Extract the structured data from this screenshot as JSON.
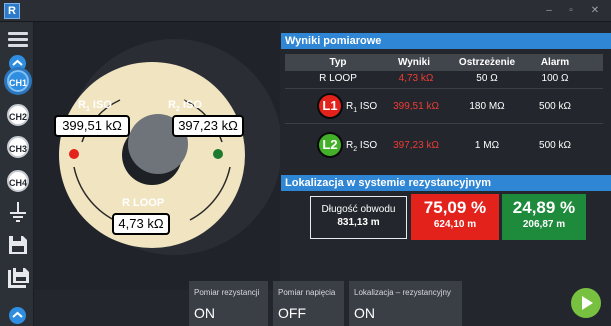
{
  "window": {
    "app_icon_letter": "R",
    "minimize": "–",
    "maximize": "▫",
    "close": "✕"
  },
  "sidebar": {
    "channels": [
      "CH1",
      "CH2",
      "CH3",
      "CH4"
    ],
    "active_channel": "CH1"
  },
  "diagram": {
    "r1_label_main": "R",
    "r1_label_sub": "1",
    "r1_label_suffix": "ISO",
    "r1_value": "399,51 kΩ",
    "r2_label_main": "R",
    "r2_label_sub": "2",
    "r2_label_suffix": "ISO",
    "r2_value": "397,23 kΩ",
    "rloop_label": "R LOOP",
    "rloop_value": "4,73 kΩ",
    "colors": {
      "ring": "#f1e4c0",
      "left_dot": "#e3221c",
      "right_dot": "#1d7a2e"
    }
  },
  "results": {
    "header": "Wyniki pomiarowe",
    "columns": [
      "Typ",
      "Wyniki",
      "Ostrzeżenie",
      "Alarm"
    ],
    "rows": [
      {
        "typ": "R LOOP",
        "wynik": "4,73 kΩ",
        "ostrzezenie": "50 Ω",
        "alarm": "100 Ω"
      },
      {
        "badge": "L1",
        "typ_main": "R",
        "typ_sub": "1",
        "typ_suffix": " ISO",
        "wynik": "399,51 kΩ",
        "ostrzezenie": "180 MΩ",
        "alarm": "500 kΩ"
      },
      {
        "badge": "L2",
        "typ_main": "R",
        "typ_sub": "2",
        "typ_suffix": " ISO",
        "wynik": "397,23 kΩ",
        "ostrzezenie": "1 MΩ",
        "alarm": "500 kΩ"
      }
    ],
    "colors": {
      "l1_badge": "#e3221c",
      "l2_badge": "#43b02a",
      "alarm_text": "#ef3b34"
    }
  },
  "localization": {
    "header": "Lokalizacja w systemie rezystancyjnym",
    "length_label": "Długość obwodu",
    "length_value": "831,13 m",
    "left_percent": "75,09 %",
    "left_distance": "624,10 m",
    "right_percent": "24,89 %",
    "right_distance": "206,87 m",
    "colors": {
      "left": "#e3221c",
      "right": "#1d8a3c"
    }
  },
  "bottom_tabs": [
    {
      "label": "Pomiar rezystancji",
      "value": "ON"
    },
    {
      "label": "Pomiar napięcia",
      "value": "OFF"
    },
    {
      "label": "Lokalizacja – rezystancyjny",
      "value": "ON"
    }
  ],
  "accent": "#2f86d5"
}
